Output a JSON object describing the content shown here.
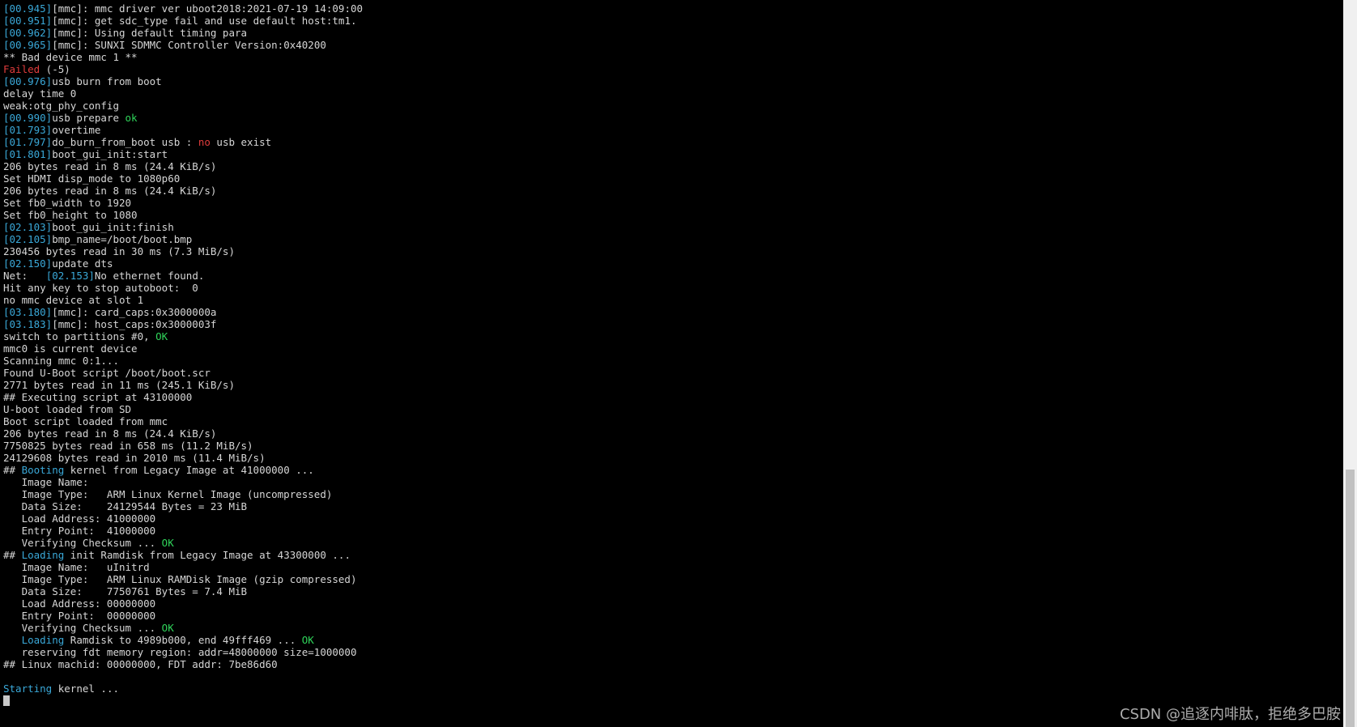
{
  "colors": {
    "background": "#000000",
    "text": "#d6d6d6",
    "timestamp": "#3aa8d8",
    "error": "#e03c3c",
    "ok": "#2fd45a",
    "keyword": "#3aa8d8"
  },
  "terminal": {
    "lines": [
      [
        {
          "t": "[00.945]",
          "c": "ts"
        },
        {
          "t": "[mmc]: mmc driver ver uboot2018:2021-07-19 14:09:00"
        }
      ],
      [
        {
          "t": "[00.951]",
          "c": "ts"
        },
        {
          "t": "[mmc]: get sdc_type fail and use default host:tm1."
        }
      ],
      [
        {
          "t": "[00.962]",
          "c": "ts"
        },
        {
          "t": "[mmc]: Using default timing para"
        }
      ],
      [
        {
          "t": "[00.965]",
          "c": "ts"
        },
        {
          "t": "[mmc]: SUNXI SDMMC Controller Version:0x40200"
        }
      ],
      [
        {
          "t": "** Bad device mmc 1 **"
        }
      ],
      [
        {
          "t": "Failed",
          "c": "red"
        },
        {
          "t": " (-5)"
        }
      ],
      [
        {
          "t": "[00.976]",
          "c": "ts"
        },
        {
          "t": "usb burn from boot"
        }
      ],
      [
        {
          "t": "delay time 0"
        }
      ],
      [
        {
          "t": "weak:otg_phy_config"
        }
      ],
      [
        {
          "t": "[00.990]",
          "c": "ts"
        },
        {
          "t": "usb prepare "
        },
        {
          "t": "ok",
          "c": "green"
        }
      ],
      [
        {
          "t": "[01.793]",
          "c": "ts"
        },
        {
          "t": "overtime"
        }
      ],
      [
        {
          "t": "[01.797]",
          "c": "ts"
        },
        {
          "t": "do_burn_from_boot usb : "
        },
        {
          "t": "no",
          "c": "red"
        },
        {
          "t": " usb exist"
        }
      ],
      [
        {
          "t": "[01.801]",
          "c": "ts"
        },
        {
          "t": "boot_gui_init:start"
        }
      ],
      [
        {
          "t": "206 bytes read in 8 ms (24.4 KiB/s)"
        }
      ],
      [
        {
          "t": "Set HDMI disp_mode to 1080p60"
        }
      ],
      [
        {
          "t": "206 bytes read in 8 ms (24.4 KiB/s)"
        }
      ],
      [
        {
          "t": "Set fb0_width to 1920"
        }
      ],
      [
        {
          "t": "Set fb0_height to 1080"
        }
      ],
      [
        {
          "t": "[02.103]",
          "c": "ts"
        },
        {
          "t": "boot_gui_init:finish"
        }
      ],
      [
        {
          "t": "[02.105]",
          "c": "ts"
        },
        {
          "t": "bmp_name=/boot/boot.bmp"
        }
      ],
      [
        {
          "t": "230456 bytes read in 30 ms (7.3 MiB/s)"
        }
      ],
      [
        {
          "t": "[02.150]",
          "c": "ts"
        },
        {
          "t": "update dts"
        }
      ],
      [
        {
          "t": "Net:   "
        },
        {
          "t": "[02.153]",
          "c": "ts"
        },
        {
          "t": "No ethernet found."
        }
      ],
      [
        {
          "t": "Hit any key to stop autoboot:  0"
        }
      ],
      [
        {
          "t": "no mmc device at slot 1"
        }
      ],
      [
        {
          "t": "[03.180]",
          "c": "ts"
        },
        {
          "t": "[mmc]: card_caps:0x3000000a"
        }
      ],
      [
        {
          "t": "[03.183]",
          "c": "ts"
        },
        {
          "t": "[mmc]: host_caps:0x3000003f"
        }
      ],
      [
        {
          "t": "switch to partitions #0, "
        },
        {
          "t": "OK",
          "c": "green"
        }
      ],
      [
        {
          "t": "mmc0 is current device"
        }
      ],
      [
        {
          "t": "Scanning mmc 0:1..."
        }
      ],
      [
        {
          "t": "Found U-Boot script /boot/boot.scr"
        }
      ],
      [
        {
          "t": "2771 bytes read in 11 ms (245.1 KiB/s)"
        }
      ],
      [
        {
          "t": "## Executing script at 43100000"
        }
      ],
      [
        {
          "t": "U-boot loaded from SD"
        }
      ],
      [
        {
          "t": "Boot script loaded from mmc"
        }
      ],
      [
        {
          "t": "206 bytes read in 8 ms (24.4 KiB/s)"
        }
      ],
      [
        {
          "t": "7750825 bytes read in 658 ms (11.2 MiB/s)"
        }
      ],
      [
        {
          "t": "24129608 bytes read in 2010 ms (11.4 MiB/s)"
        }
      ],
      [
        {
          "t": "## "
        },
        {
          "t": "Booting",
          "c": "blue"
        },
        {
          "t": " kernel from Legacy Image at 41000000 ..."
        }
      ],
      [
        {
          "t": "   Image Name:"
        }
      ],
      [
        {
          "t": "   Image Type:   ARM Linux Kernel Image (uncompressed)"
        }
      ],
      [
        {
          "t": "   Data Size:    24129544 Bytes = 23 MiB"
        }
      ],
      [
        {
          "t": "   Load Address: 41000000"
        }
      ],
      [
        {
          "t": "   Entry Point:  41000000"
        }
      ],
      [
        {
          "t": "   Verifying Checksum ... "
        },
        {
          "t": "OK",
          "c": "green"
        }
      ],
      [
        {
          "t": "## "
        },
        {
          "t": "Loading",
          "c": "blue"
        },
        {
          "t": " init Ramdisk from Legacy Image at 43300000 ..."
        }
      ],
      [
        {
          "t": "   Image Name:   uInitrd"
        }
      ],
      [
        {
          "t": "   Image Type:   ARM Linux RAMDisk Image (gzip compressed)"
        }
      ],
      [
        {
          "t": "   Data Size:    7750761 Bytes = 7.4 MiB"
        }
      ],
      [
        {
          "t": "   Load Address: 00000000"
        }
      ],
      [
        {
          "t": "   Entry Point:  00000000"
        }
      ],
      [
        {
          "t": "   Verifying Checksum ... "
        },
        {
          "t": "OK",
          "c": "green"
        }
      ],
      [
        {
          "t": "   "
        },
        {
          "t": "Loading",
          "c": "blue"
        },
        {
          "t": " Ramdisk to 4989b000, end 49fff469 ... "
        },
        {
          "t": "OK",
          "c": "green"
        }
      ],
      [
        {
          "t": "   reserving fdt memory region: addr=48000000 size=1000000"
        }
      ],
      [
        {
          "t": "## Linux machid: 00000000, FDT addr: 7be86d60"
        }
      ],
      [],
      [
        {
          "t": "Starting",
          "c": "blue"
        },
        {
          "t": " kernel ..."
        }
      ],
      []
    ]
  },
  "watermark": {
    "text": "CSDN @追逐内啡肽，拒绝多巴胺"
  }
}
